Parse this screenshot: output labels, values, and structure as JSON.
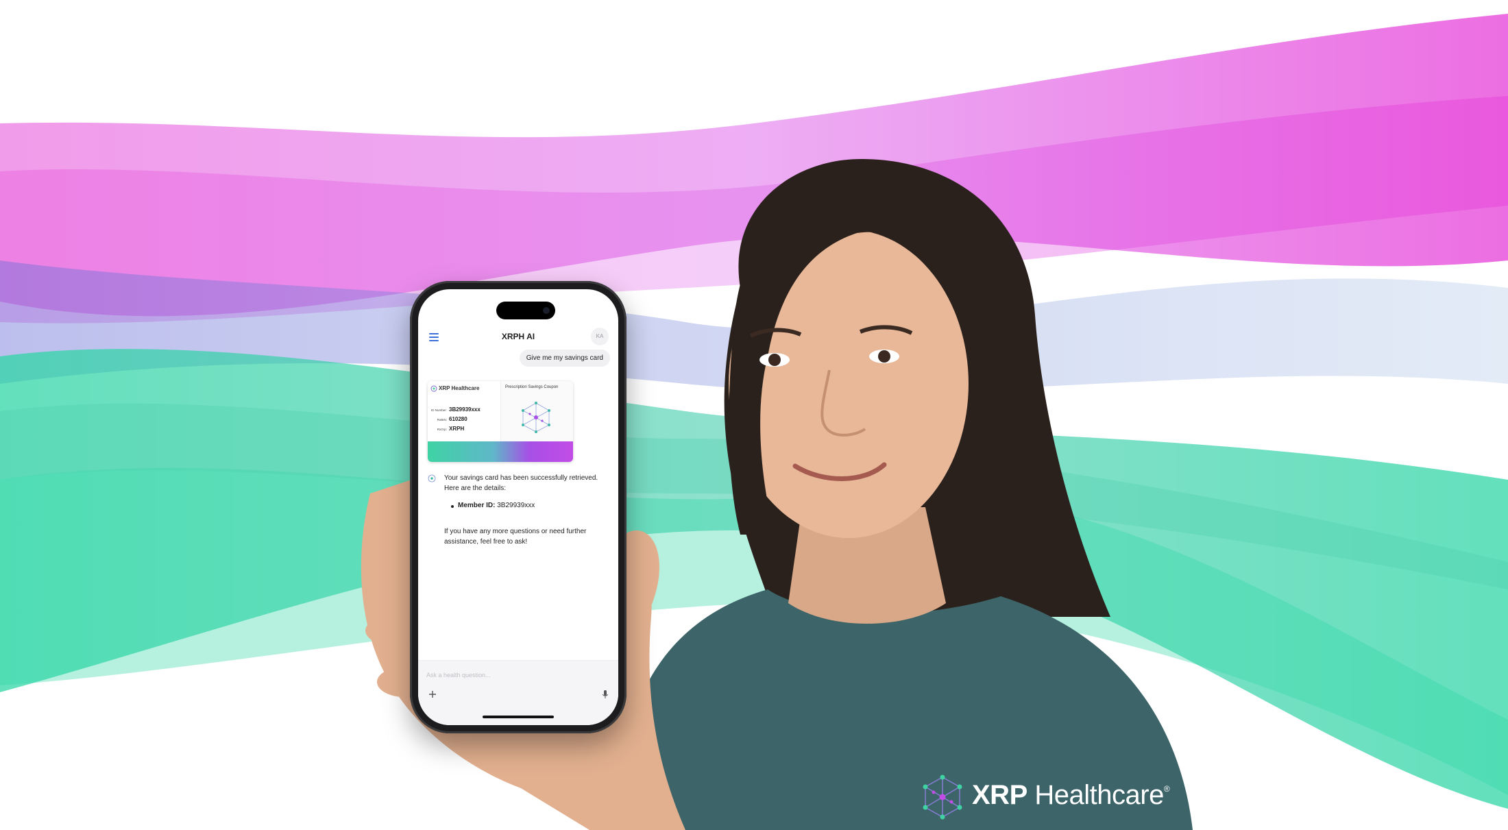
{
  "app": {
    "title": "XRPH AI",
    "avatar_initials": "KA",
    "user_message": "Give me my savings card",
    "card": {
      "brand": "XRP Healthcare",
      "coupon_title": "Prescription Savings Coupon",
      "id_value": "3B29939xxx",
      "bin_value": "610280",
      "group_value": "XRPH"
    },
    "assistant_message": "Your savings card has been successfully retrieved. Here are the details:",
    "detail_label": "Member ID:",
    "detail_value": "3B29939xxx",
    "followup": "If you have any more questions or need further assistance, feel free to ask!",
    "composer_placeholder": "Ask a health question..."
  },
  "branding": {
    "name_bold": "XRP",
    "name_light": "Healthcare",
    "trademark": "®"
  },
  "colors": {
    "wave_magenta": "#e23ee0",
    "wave_teal": "#2fd6a6",
    "accent_blue": "#3a6fd8",
    "shirt": "#3d6469"
  },
  "icons": [
    "menu-icon",
    "plus-icon",
    "microphone-icon",
    "xrp-healthcare-logo"
  ]
}
